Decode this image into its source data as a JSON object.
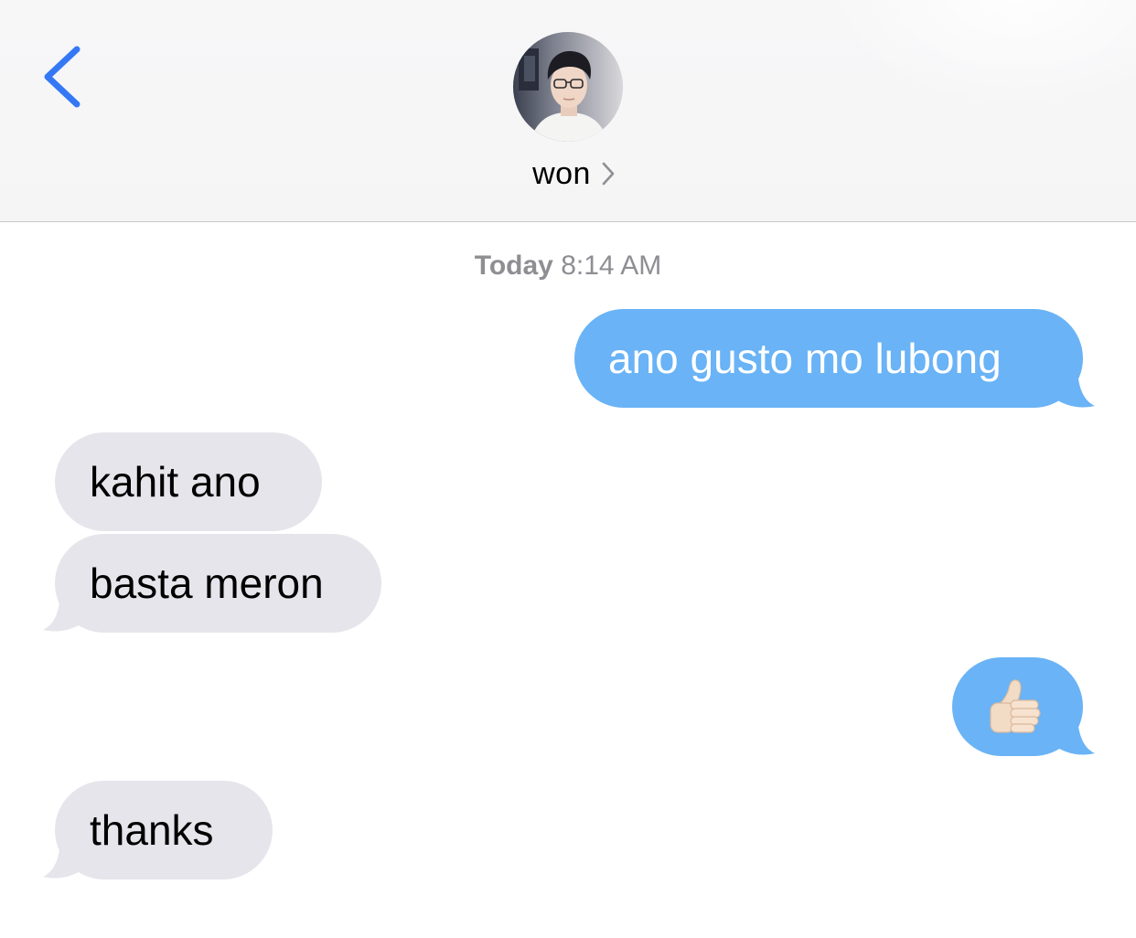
{
  "header": {
    "contact_name": "won",
    "back_icon": "chevron-left-icon",
    "detail_icon": "chevron-right-icon",
    "accent_color": "#3478f6"
  },
  "conversation": {
    "timestamp_day": "Today",
    "timestamp_time": "8:14 AM",
    "messages": [
      {
        "direction": "outgoing",
        "text": "ano gusto mo lubong"
      },
      {
        "direction": "incoming",
        "text": "kahit ano"
      },
      {
        "direction": "incoming",
        "text": "basta meron"
      },
      {
        "direction": "outgoing",
        "emoji": "thumbs-up"
      },
      {
        "direction": "incoming",
        "text": "thanks"
      }
    ]
  },
  "colors": {
    "outgoing_bubble": "#69b3f6",
    "incoming_bubble": "#e6e5eb",
    "timestamp_text": "#8e8e93"
  }
}
